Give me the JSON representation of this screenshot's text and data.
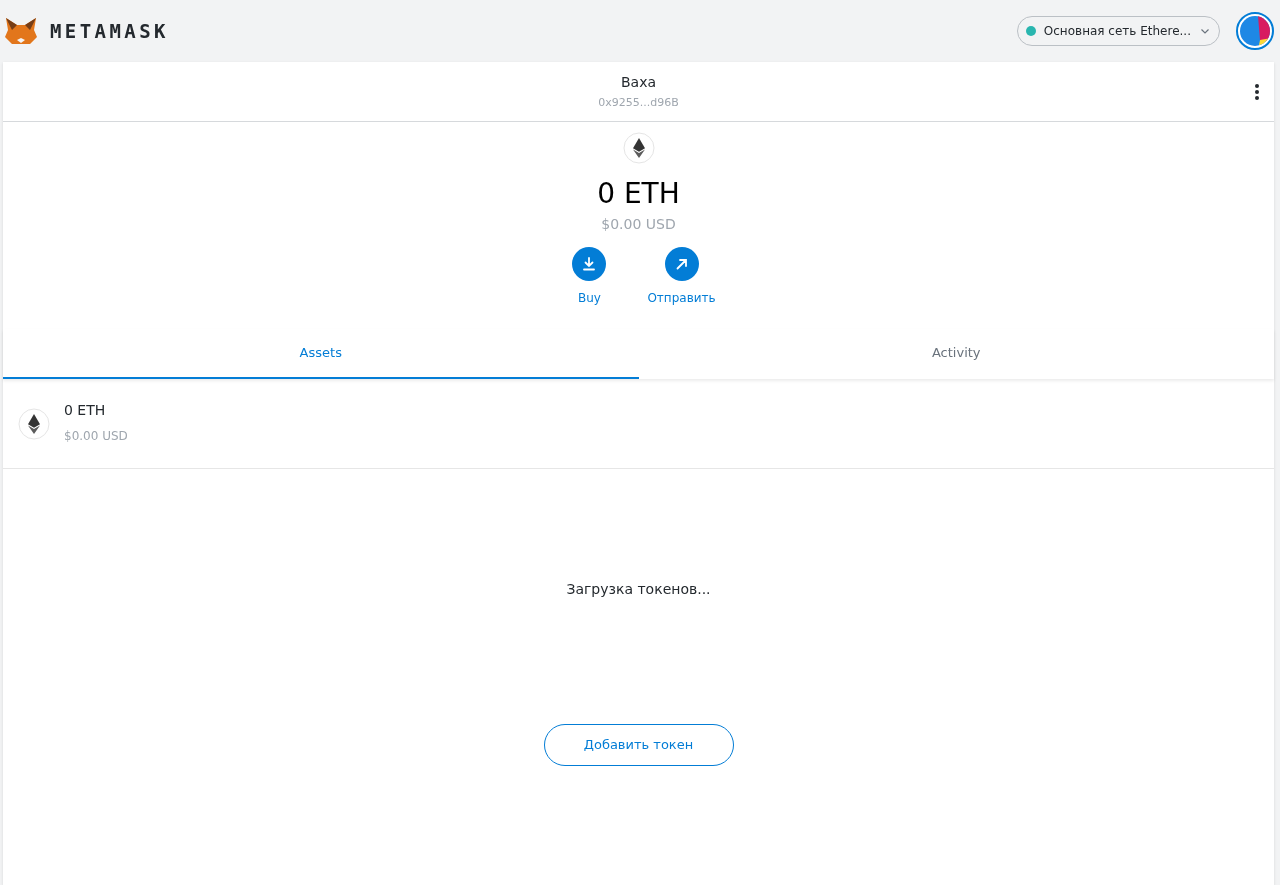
{
  "header": {
    "logo": "METAMASK",
    "network": {
      "label": "Основная сеть Ethere...",
      "color": "#29b6af"
    }
  },
  "account": {
    "name": "Baxa",
    "address": "0x9255...d96B"
  },
  "balance": {
    "amount": "0 ETH",
    "fiat": "$0.00 USD"
  },
  "actions": [
    {
      "kind": "buy",
      "label": "Buy"
    },
    {
      "kind": "send",
      "label": "Отправить"
    }
  ],
  "tabs": [
    {
      "label": "Assets",
      "selected": true
    },
    {
      "label": "Activity",
      "selected": false
    }
  ],
  "assets": [
    {
      "amount": "0 ETH",
      "fiat": "$0.00 USD"
    }
  ],
  "loading": "Загрузка токенов...",
  "add_token_button": "Добавить токен"
}
